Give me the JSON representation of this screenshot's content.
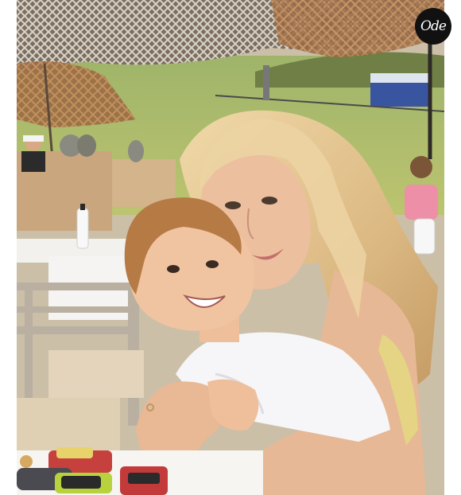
{
  "photo": {
    "description_icon": "photo-icon",
    "palette": {
      "sky_hill": "#a9b860",
      "net": "#8a7c6c",
      "table": "#f4f2ee",
      "hair_mom": "#e3c48f",
      "hair_child": "#b47a45",
      "shirt": "#f5f5f7",
      "skin": "#e8b896"
    }
  },
  "logo": {
    "text": "Ode",
    "icon": "brand-logo-icon",
    "background": "#111111"
  }
}
